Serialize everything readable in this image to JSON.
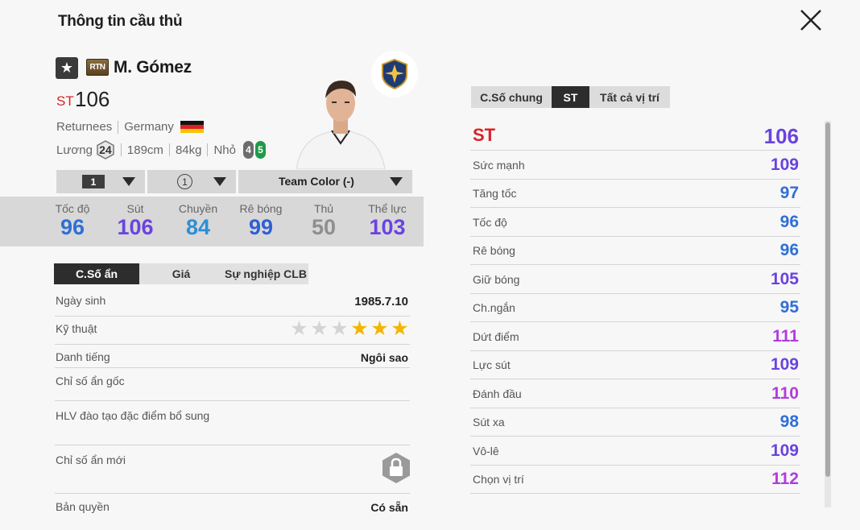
{
  "window": {
    "title": "Thông tin cầu thủ"
  },
  "player": {
    "name": "M. Gómez",
    "season_badge": "RTN",
    "position": "ST",
    "overall": "106",
    "season_name": "Returnees",
    "nation": "Germany",
    "salary_label": "Lương",
    "salary": "24",
    "height": "189cm",
    "weight": "84kg",
    "body_type": "Nhỏ",
    "weak_foot_left": "4",
    "weak_foot_right": "5"
  },
  "selectors": {
    "level": "1",
    "team_count": "1",
    "team_color": "Team Color (-)"
  },
  "main_stats": [
    {
      "label": "Tốc độ",
      "value": "96",
      "color": "#2f6fd6"
    },
    {
      "label": "Sút",
      "value": "106",
      "color": "#6a43e0"
    },
    {
      "label": "Chuyền",
      "value": "84",
      "color": "#2b8fd8"
    },
    {
      "label": "Rê bóng",
      "value": "99",
      "color": "#2f5fd4"
    },
    {
      "label": "Thủ",
      "value": "50",
      "color": "#8f8f8f"
    },
    {
      "label": "Thể lực",
      "value": "103",
      "color": "#6a43e0"
    }
  ],
  "left_tabs": [
    "C.Số ẩn",
    "Giá",
    "Sự nghiệp CLB"
  ],
  "info": {
    "birthday_label": "Ngày sinh",
    "birthday": "1985.7.10",
    "skill_label": "Kỹ thuật",
    "skill_stars": 3,
    "skill_stars_total": 6,
    "reputation_label": "Danh tiếng",
    "reputation": "Ngôi sao",
    "hidden_traits_label": "Chỉ số ẩn gốc",
    "coach_traits_label": "HLV đào tạo đặc điểm bổ sung",
    "new_traits_label": "Chỉ số ẩn mới",
    "license_label": "Bản quyền",
    "license": "Có sẵn"
  },
  "right_tabs": [
    "C.Số chung",
    "ST",
    "Tất cả vị trí"
  ],
  "position_stats": [
    {
      "label": "ST",
      "value": "106",
      "color": "#6a43e0"
    },
    {
      "label": "Sức mạnh",
      "value": "109",
      "color": "#6a43e0"
    },
    {
      "label": "Tăng tốc",
      "value": "97",
      "color": "#2f6fd6"
    },
    {
      "label": "Tốc độ",
      "value": "96",
      "color": "#2f6fd6"
    },
    {
      "label": "Rê bóng",
      "value": "96",
      "color": "#2f6fd6"
    },
    {
      "label": "Giữ bóng",
      "value": "105",
      "color": "#6a43e0"
    },
    {
      "label": "Ch.ngắn",
      "value": "95",
      "color": "#2f6fd6"
    },
    {
      "label": "Dứt điểm",
      "value": "111",
      "color": "#b23be0"
    },
    {
      "label": "Lực sút",
      "value": "109",
      "color": "#6a43e0"
    },
    {
      "label": "Đánh đầu",
      "value": "110",
      "color": "#b23be0"
    },
    {
      "label": "Sút xa",
      "value": "98",
      "color": "#2f6fd6"
    },
    {
      "label": "Vô-lê",
      "value": "109",
      "color": "#6a43e0"
    },
    {
      "label": "Chọn vị trí",
      "value": "112",
      "color": "#b23be0"
    }
  ]
}
